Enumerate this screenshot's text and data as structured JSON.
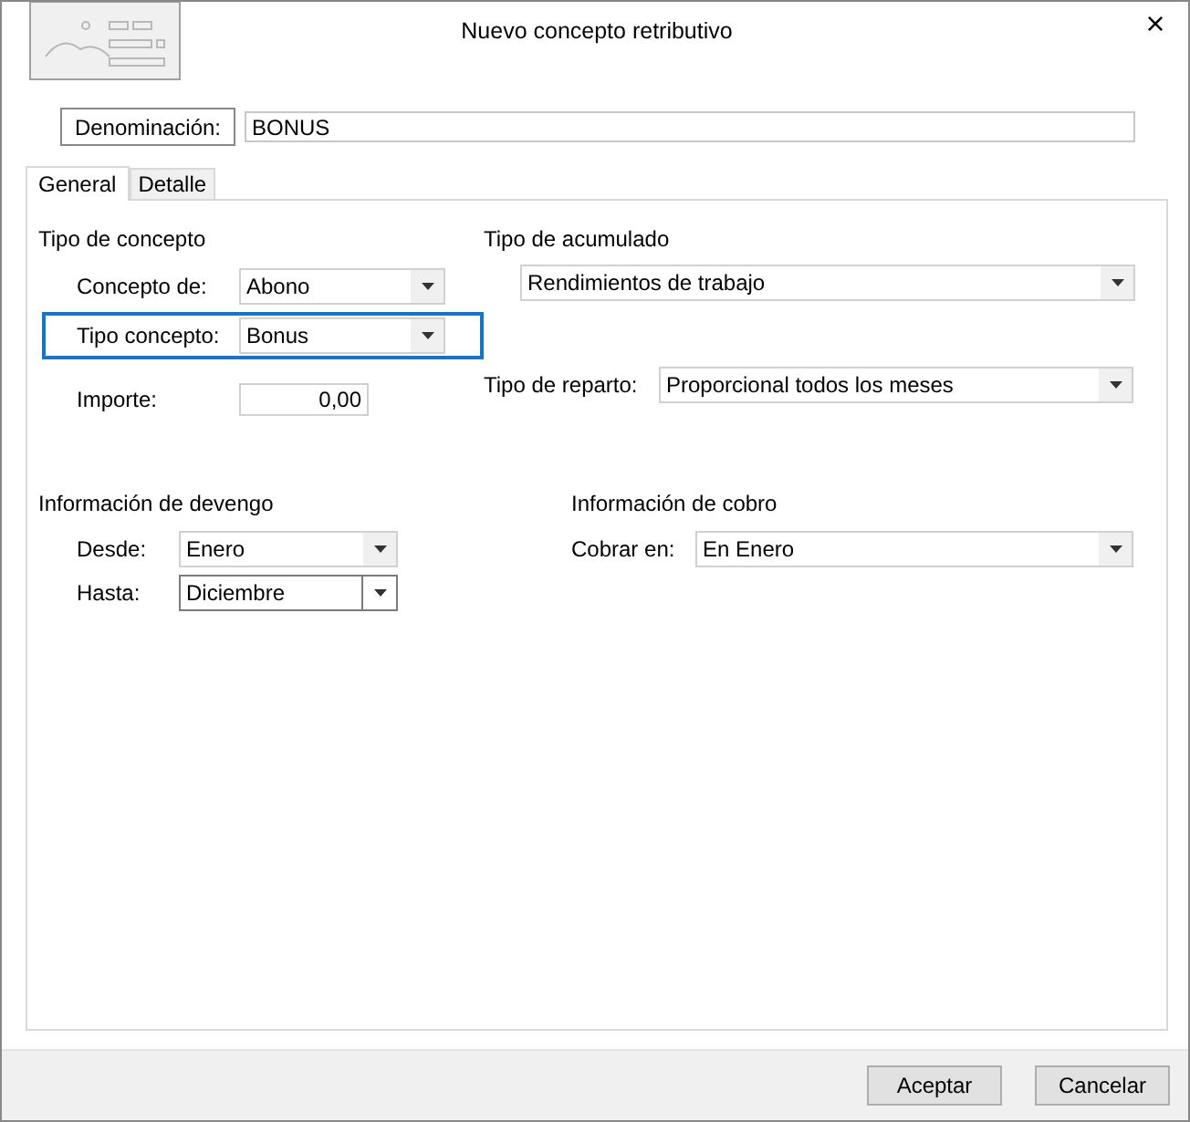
{
  "window": {
    "title": "Nuevo concepto retributivo",
    "close": "×"
  },
  "denominacion": {
    "label": "Denominación:",
    "value": "BONUS"
  },
  "tabs": [
    {
      "label": "General",
      "selected": true
    },
    {
      "label": "Detalle",
      "selected": false
    }
  ],
  "tipo_concepto": {
    "heading": "Tipo de concepto",
    "fields": [
      {
        "label": "Concepto de:",
        "kind": "select",
        "value": "Abono"
      },
      {
        "label": "Tipo concepto:",
        "kind": "select",
        "value": "Bonus",
        "focused": true
      },
      {
        "label": "Importe:",
        "kind": "number",
        "value": "0,00"
      }
    ]
  },
  "tipo_acumulado": {
    "heading": "Tipo de acumulado",
    "value": "Rendimientos de trabajo"
  },
  "tipo_reparto": {
    "label": "Tipo de reparto:",
    "value": "Proporcional todos los meses"
  },
  "devengo": {
    "heading": "Información de devengo",
    "fields": [
      {
        "label": "Desde:",
        "value": "Enero",
        "hovered": false
      },
      {
        "label": "Hasta:",
        "value": "Diciembre",
        "hovered": true
      }
    ]
  },
  "cobro": {
    "heading": "Información de cobro",
    "label": "Cobrar en:",
    "value": "En Enero"
  },
  "buttons": [
    "Aceptar",
    "Cancelar"
  ]
}
